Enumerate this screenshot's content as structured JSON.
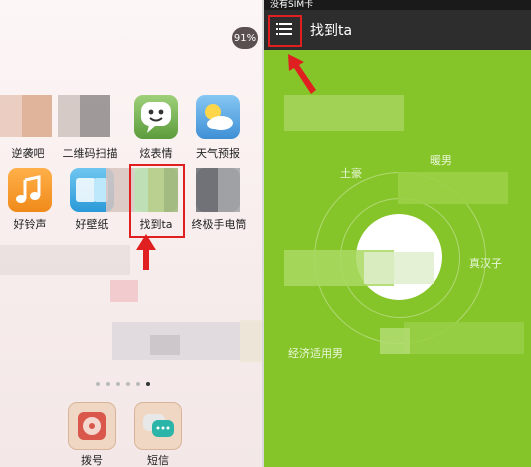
{
  "left_panel": {
    "battery_badge": "91%",
    "apps_row1": [
      {
        "label": "逆袭吧"
      },
      {
        "label": "二维码扫描"
      },
      {
        "label": "炫表情"
      },
      {
        "label": "天气预报"
      }
    ],
    "apps_row2": [
      {
        "label": "好铃声"
      },
      {
        "label": "好壁纸"
      },
      {
        "label": "找到ta"
      },
      {
        "label": "终极手电筒"
      }
    ],
    "page_dots": {
      "count": 6,
      "active_index": 5
    },
    "dock": [
      {
        "label": "拨号"
      },
      {
        "label": "短信"
      }
    ]
  },
  "right_panel": {
    "status_text": "没有SIM卡",
    "title": "找到ta",
    "map_labels": [
      "土豪",
      "暖男",
      "真汉子",
      "经济适用男"
    ]
  },
  "colors": {
    "highlight": "#e02020",
    "app_green": "#86c52a",
    "topbar": "#2d2d2d"
  }
}
